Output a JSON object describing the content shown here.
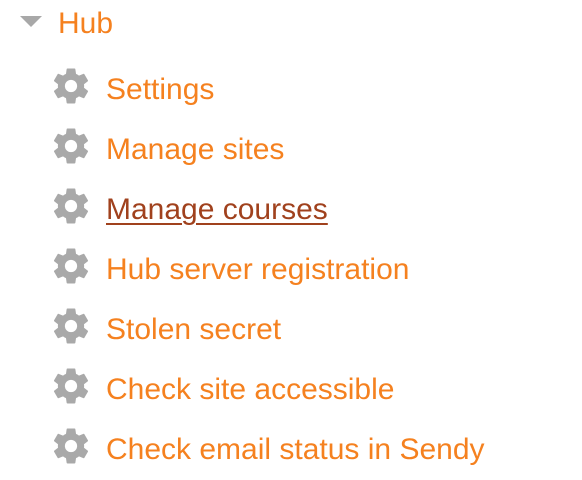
{
  "tree": {
    "root_label": "Hub",
    "items": [
      {
        "label": "Settings",
        "icon": "gear-icon",
        "state": "normal"
      },
      {
        "label": "Manage sites",
        "icon": "gear-icon",
        "state": "normal"
      },
      {
        "label": "Manage courses",
        "icon": "gear-icon",
        "state": "hover-underlined"
      },
      {
        "label": "Hub server registration",
        "icon": "gear-icon",
        "state": "normal"
      },
      {
        "label": "Stolen secret",
        "icon": "gear-icon",
        "state": "normal"
      },
      {
        "label": "Check site accessible",
        "icon": "gear-icon",
        "state": "normal"
      },
      {
        "label": "Check email status in Sendy",
        "icon": "gear-icon",
        "state": "normal"
      }
    ]
  },
  "colors": {
    "link": "#f5811f",
    "link_hover": "#a0411d",
    "caret": "#a8a8a8",
    "gear": "#a9a9a9"
  }
}
